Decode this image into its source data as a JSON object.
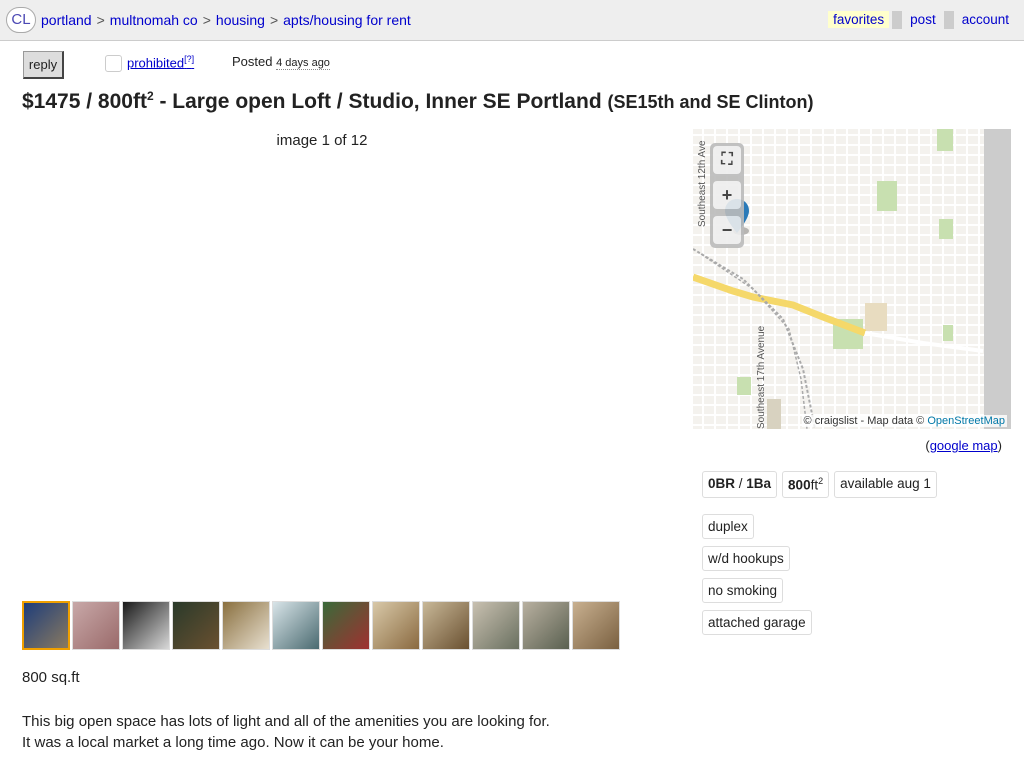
{
  "topbar": {
    "logo": "CL",
    "breadcrumbs": [
      "portland",
      "multnomah co",
      "housing",
      "apts/housing for rent"
    ],
    "separator": ">",
    "favorites": "favorites",
    "post": "post",
    "account": "account"
  },
  "actions": {
    "reply": "reply",
    "prohibited": "prohibited",
    "help": "?",
    "posted_label": "Posted",
    "posted_when": "4 days ago"
  },
  "title": {
    "price": "$1475",
    "sep1": " / ",
    "size": "800ft",
    "size_sup": "2",
    "text": " - Large open Loft / Studio, Inner SE Portland ",
    "location": "(SE15th and SE Clinton)"
  },
  "gallery": {
    "count": "image 1 of 12",
    "thumbs": [
      {
        "colors": [
          "#1e3d7a",
          "#8a7a60"
        ],
        "name": "thumb-1"
      },
      {
        "colors": [
          "#c8a8a8",
          "#9a6a6a"
        ],
        "name": "thumb-2"
      },
      {
        "colors": [
          "#1a1a1a",
          "#d8d8d8"
        ],
        "name": "thumb-3"
      },
      {
        "colors": [
          "#2a3a2a",
          "#6a5030"
        ],
        "name": "thumb-4"
      },
      {
        "colors": [
          "#8a7040",
          "#e8e0d0"
        ],
        "name": "thumb-5"
      },
      {
        "colors": [
          "#d8e4e8",
          "#4a6a70"
        ],
        "name": "thumb-6"
      },
      {
        "colors": [
          "#3a6a3a",
          "#a03030"
        ],
        "name": "thumb-7"
      },
      {
        "colors": [
          "#d8c8a8",
          "#8a6a40"
        ],
        "name": "thumb-8"
      },
      {
        "colors": [
          "#c8b898",
          "#6a5030"
        ],
        "name": "thumb-9"
      },
      {
        "colors": [
          "#c8c0b0",
          "#6a7060"
        ],
        "name": "thumb-10"
      },
      {
        "colors": [
          "#b8b0a0",
          "#5a6050"
        ],
        "name": "thumb-11"
      },
      {
        "colors": [
          "#c8b090",
          "#7a6040"
        ],
        "name": "thumb-12"
      }
    ]
  },
  "map": {
    "fullscreen": "⛶",
    "zoom_in": "+",
    "zoom_out": "−",
    "street_12th": "Southeast 12th Ave",
    "street_17th": "Southeast 17th Avenue",
    "attribution_prefix": "© craigslist - Map data © ",
    "attribution_link": "OpenStreetMap",
    "google_map_open": "(",
    "google_map": "google map",
    "google_map_close": ")"
  },
  "attributes": {
    "br": "0BR",
    "slash": " / ",
    "ba": "1Ba",
    "sqft": "800",
    "sqft_unit": "ft",
    "sqft_sup": "2",
    "available": "available aug 1",
    "tags": [
      "duplex",
      "w/d hookups",
      "no smoking",
      "attached garage"
    ]
  },
  "body": {
    "sqft_line": "800 sq.ft",
    "desc_line1": "This big open space has lots of light and all of the amenities you are looking for.",
    "desc_line2": "It was a local market a long time ago. Now it can be your home."
  },
  "colors": {
    "link": "#0000cc",
    "topbar_bg": "#eeeeee",
    "favorites_bg": "#ffffcc",
    "thumb_active": "#f0a000",
    "map_road_yellow": "#f5d86a",
    "map_marker": "#2a7ab8"
  }
}
